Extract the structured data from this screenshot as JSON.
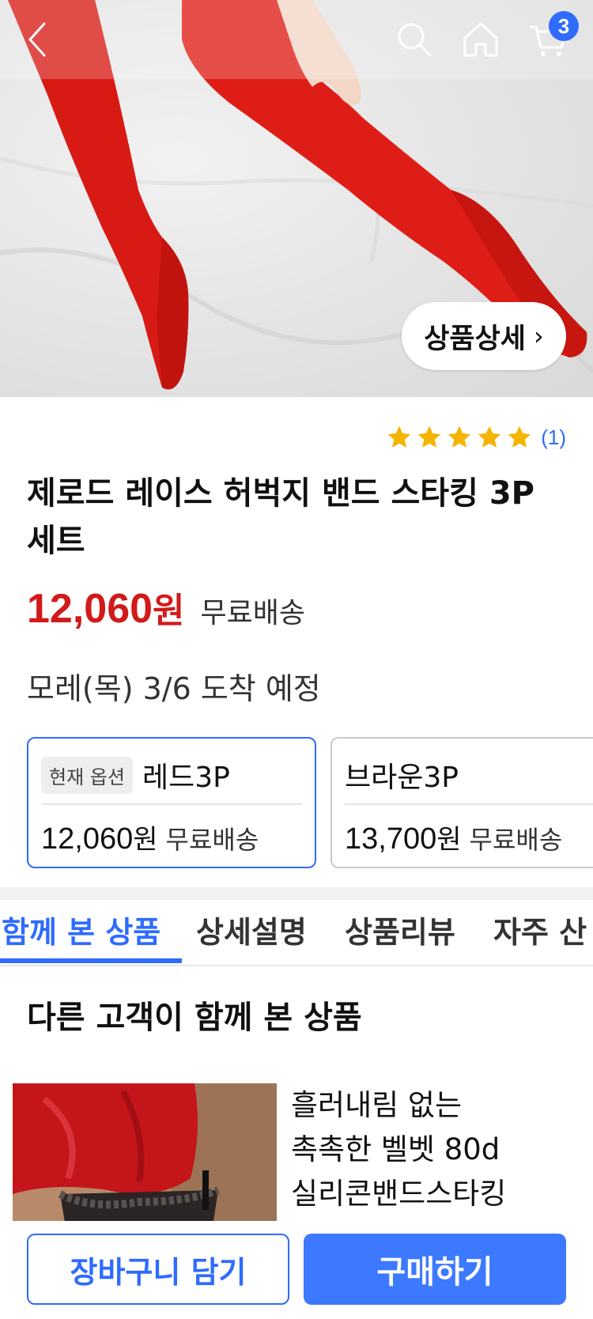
{
  "header": {
    "cart_count": "3",
    "detail_button_label": "상품상세",
    "icons": [
      "back-arrow-icon",
      "search-icon",
      "home-icon",
      "cart-icon"
    ]
  },
  "product": {
    "rating_count": "(1)",
    "stars": 5,
    "title_line1": "제로드 레이스 허벅지 밴드 스타킹 3P",
    "title_line2": "세트",
    "price": "12,060",
    "currency": "원",
    "shipping": "무료배송",
    "delivery": "모레(목) 3/6 도착 예정"
  },
  "options": [
    {
      "tag": "현재 옵션",
      "name": "레드3P",
      "price": "12,060",
      "currency": "원",
      "shipping": "무료배송",
      "selected": true
    },
    {
      "tag": "",
      "name": "브라운3P",
      "price": "13,700",
      "currency": "원",
      "shipping": "무료배송",
      "selected": false
    }
  ],
  "tabs": [
    {
      "label": "함께 본 상품",
      "active": true
    },
    {
      "label": "상세설명",
      "active": false
    },
    {
      "label": "상품리뷰",
      "active": false
    },
    {
      "label": "자주 산",
      "active": false
    }
  ],
  "recommend": {
    "section_title": "다른 고객이 함께 본 상품",
    "item_title": "흘러내림 없는\n촉촉한 벨벳 80d\n실리콘밴드스타킹"
  },
  "bottom": {
    "cart_button": "장바구니 담기",
    "buy_button": "구매하기"
  },
  "colors": {
    "accent": "#2f6bff",
    "price": "#d11a1a",
    "star": "#f5b400"
  }
}
